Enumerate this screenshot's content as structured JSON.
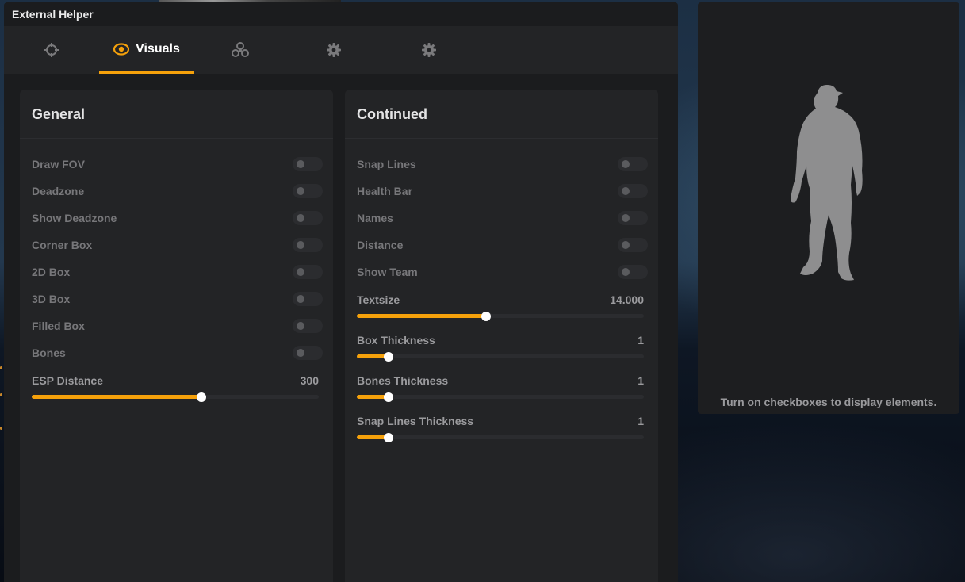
{
  "window": {
    "title": "External Helper"
  },
  "tabs": [
    {
      "label": "",
      "icon": "crosshair-icon"
    },
    {
      "label": "Visuals",
      "icon": "eye-icon",
      "active": true
    },
    {
      "label": "",
      "icon": "biohazard-icon"
    },
    {
      "label": "",
      "icon": "gear-icon"
    },
    {
      "label": "",
      "icon": "gear-icon"
    }
  ],
  "general": {
    "title": "General",
    "toggles": [
      {
        "label": "Draw FOV",
        "on": false
      },
      {
        "label": "Deadzone",
        "on": false
      },
      {
        "label": "Show Deadzone",
        "on": false
      },
      {
        "label": "Corner Box",
        "on": false
      },
      {
        "label": "2D Box",
        "on": false
      },
      {
        "label": "3D Box",
        "on": false
      },
      {
        "label": "Filled Box",
        "on": false
      },
      {
        "label": "Bones",
        "on": false
      }
    ],
    "sliders": [
      {
        "label": "ESP Distance",
        "value": "300",
        "fraction": 0.59
      }
    ]
  },
  "continued": {
    "title": "Continued",
    "toggles": [
      {
        "label": "Snap Lines",
        "on": false
      },
      {
        "label": "Health Bar",
        "on": false
      },
      {
        "label": "Names",
        "on": false
      },
      {
        "label": "Distance",
        "on": false
      },
      {
        "label": "Show Team",
        "on": false
      }
    ],
    "sliders": [
      {
        "label": "Textsize",
        "value": "14.000",
        "fraction": 0.45
      },
      {
        "label": "Box Thickness",
        "value": "1",
        "fraction": 0.11
      },
      {
        "label": "Bones Thickness",
        "value": "1",
        "fraction": 0.11
      },
      {
        "label": "Snap Lines Thickness",
        "value": "1",
        "fraction": 0.11
      }
    ]
  },
  "preview": {
    "caption": "Turn on checkboxes to display elements."
  },
  "colors": {
    "accent": "#f5a10b",
    "panel": "#232426",
    "window": "#1b1c1e"
  }
}
